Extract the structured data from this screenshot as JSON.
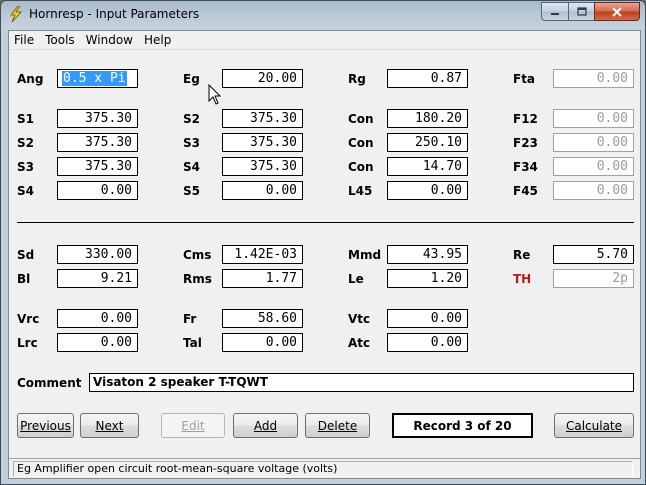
{
  "window": {
    "title": "Hornresp - Input Parameters"
  },
  "menu": [
    "File",
    "Tools",
    "Window",
    "Help"
  ],
  "params": {
    "ang": {
      "label": "Ang",
      "value": "0.5 x Pi"
    },
    "eg": {
      "label": "Eg",
      "value": "20.00"
    },
    "rg": {
      "label": "Rg",
      "value": "0.87"
    },
    "fta": {
      "label": "Fta",
      "value": "0.00"
    },
    "s1": {
      "label": "S1",
      "value": "375.30"
    },
    "s2a": {
      "label": "S2",
      "value": "375.30"
    },
    "con1": {
      "label": "Con",
      "value": "180.20"
    },
    "f12": {
      "label": "F12",
      "value": "0.00"
    },
    "s2": {
      "label": "S2",
      "value": "375.30"
    },
    "s3a": {
      "label": "S3",
      "value": "375.30"
    },
    "con2": {
      "label": "Con",
      "value": "250.10"
    },
    "f23": {
      "label": "F23",
      "value": "0.00"
    },
    "s3": {
      "label": "S3",
      "value": "375.30"
    },
    "s4a": {
      "label": "S4",
      "value": "375.30"
    },
    "con3": {
      "label": "Con",
      "value": "14.70"
    },
    "f34": {
      "label": "F34",
      "value": "0.00"
    },
    "s4": {
      "label": "S4",
      "value": "0.00"
    },
    "s5": {
      "label": "S5",
      "value": "0.00"
    },
    "l45": {
      "label": "L45",
      "value": "0.00"
    },
    "f45": {
      "label": "F45",
      "value": "0.00"
    },
    "sd": {
      "label": "Sd",
      "value": "330.00"
    },
    "cms": {
      "label": "Cms",
      "value": "1.42E-03"
    },
    "mmd": {
      "label": "Mmd",
      "value": "43.95"
    },
    "re": {
      "label": "Re",
      "value": "5.70"
    },
    "bl": {
      "label": "Bl",
      "value": "9.21"
    },
    "rms": {
      "label": "Rms",
      "value": "1.77"
    },
    "le": {
      "label": "Le",
      "value": "1.20"
    },
    "th": {
      "label": "TH",
      "value": "2p"
    },
    "vrc": {
      "label": "Vrc",
      "value": "0.00"
    },
    "fr": {
      "label": "Fr",
      "value": "58.60"
    },
    "vtc": {
      "label": "Vtc",
      "value": "0.00"
    },
    "lrc": {
      "label": "Lrc",
      "value": "0.00"
    },
    "tal": {
      "label": "Tal",
      "value": "0.00"
    },
    "atc": {
      "label": "Atc",
      "value": "0.00"
    }
  },
  "comment": {
    "label": "Comment",
    "value": "Visaton 2 speaker T-TQWT"
  },
  "buttons": {
    "previous": "Previous",
    "next": "Next",
    "edit": "Edit",
    "add": "Add",
    "delete": "Delete",
    "record": "Record 3 of 20",
    "calculate": "Calculate"
  },
  "status": "Eg  Amplifier open circuit root-mean-square voltage  (volts)",
  "colors": {
    "selection": "#3399ff",
    "th_label": "#c0171b",
    "close_button": "#c1401f"
  }
}
